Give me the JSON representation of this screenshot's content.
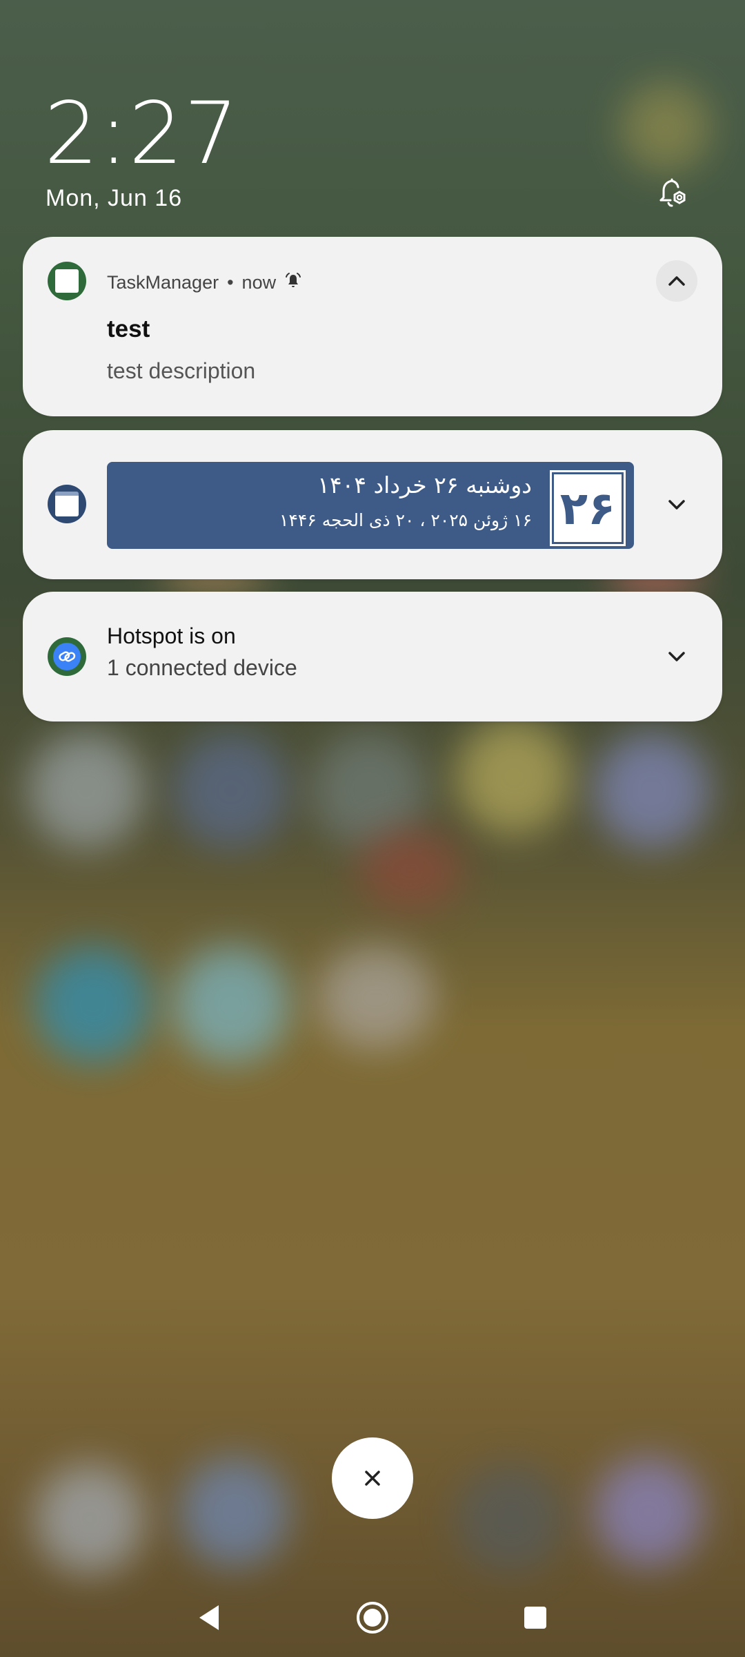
{
  "lockscreen": {
    "time": "2:27",
    "date": "Mon, Jun 16"
  },
  "notifications": [
    {
      "app_name": "TaskManager",
      "time": "now",
      "title": "test",
      "description": "test description",
      "expanded": true
    },
    {
      "persian_line1": "دوشنبه ۲۶ خرداد ۱۴۰۴",
      "persian_line2": "۱۶ ژوئن ۲۰۲۵ ، ۲۰ ذی الحجه ۱۴۴۶",
      "day_number": "۲۶",
      "expanded": false
    },
    {
      "title": "Hotspot is on",
      "subtitle": "1 connected device",
      "expanded": false
    }
  ],
  "icons": {
    "dnd_settings": "bell-settings-icon",
    "alert": "bell-alert-icon",
    "hotspot": "link-icon",
    "dismiss": "close-icon",
    "nav_back": "back-triangle-icon",
    "nav_home": "home-circle-icon",
    "nav_recents": "recents-square-icon"
  },
  "colors": {
    "card_bg": "#f2f2f2",
    "calendar_blue": "#3e5a86",
    "hotspot_blue": "#3b82f6",
    "app_icon_ring": "#2f6b3a"
  }
}
